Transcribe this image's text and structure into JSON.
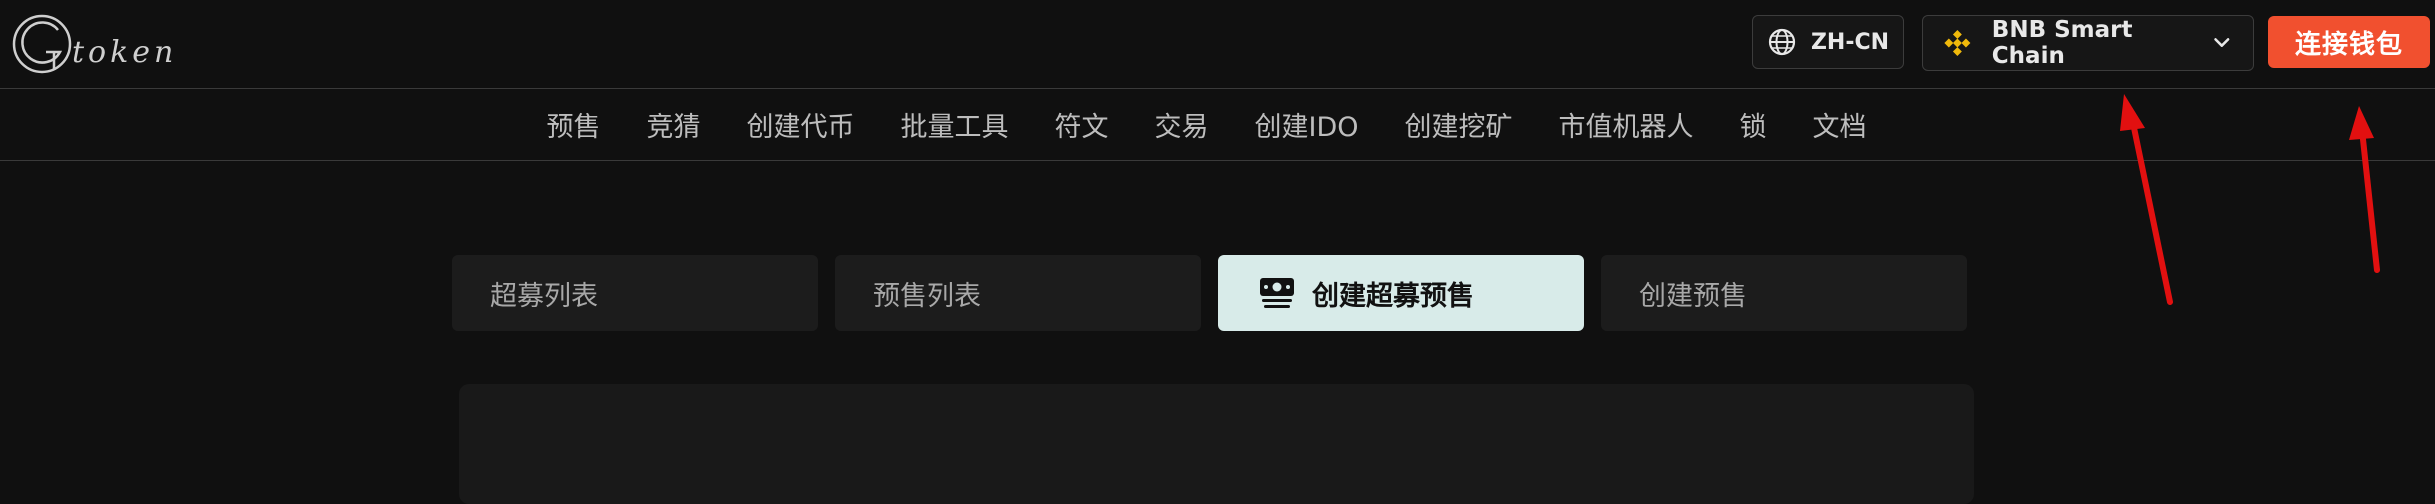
{
  "header": {
    "logo": {
      "letter": "G",
      "text": "token"
    },
    "language": {
      "label": "ZH-CN",
      "icon": "globe-icon"
    },
    "chain": {
      "label": "BNB Smart Chain",
      "icon": "bnb-chain-icon",
      "accent": "#f0b90b"
    },
    "connect_label": "连接钱包",
    "connect_color": "#f1502f"
  },
  "nav": {
    "items": [
      "预售",
      "竞猜",
      "创建代币",
      "批量工具",
      "符文",
      "交易",
      "创建IDO",
      "创建挖矿",
      "市值机器人",
      "锁",
      "文档"
    ]
  },
  "tabs": [
    {
      "label": "超募列表",
      "active": false
    },
    {
      "label": "预售列表",
      "active": false
    },
    {
      "label": "创建超募预售",
      "active": true,
      "icon": "money-stack-icon"
    },
    {
      "label": "创建预售",
      "active": false
    }
  ],
  "annotation_color": "#e21010"
}
